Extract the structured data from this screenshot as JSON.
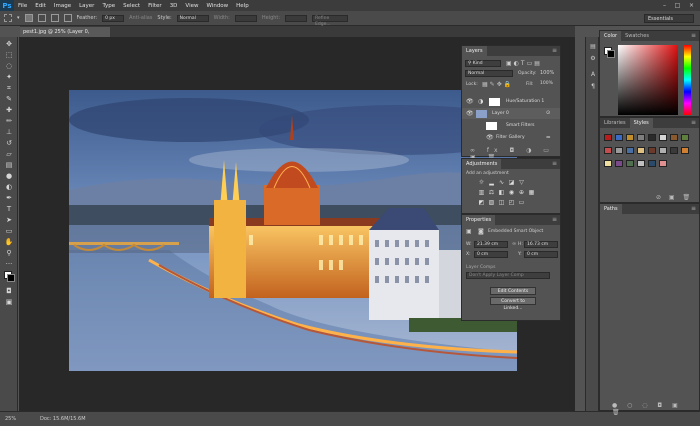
{
  "app": {
    "logo": "Ps"
  },
  "menu": [
    "File",
    "Edit",
    "Image",
    "Layer",
    "Type",
    "Select",
    "Filter",
    "3D",
    "View",
    "Window",
    "Help"
  ],
  "options": {
    "feather_label": "Feather:",
    "feather_value": "0 px",
    "antialias_label": "Anti-alias",
    "style_label": "Style:",
    "style_value": "Normal",
    "width_label": "Width:",
    "height_label": "Height:",
    "refine_label": "Refine Edge...",
    "workspace": "Essentials"
  },
  "document": {
    "tab_title": "pest1.jpg @ 25% (Layer 0, RGB/8*) ×"
  },
  "status": {
    "zoom": "25%",
    "doc": "Doc: 15.6M/15.6M"
  },
  "layers_panel": {
    "tab": "Layers",
    "kind_label": "Kind",
    "blend_mode": "Normal",
    "opacity_label": "Opacity:",
    "opacity_value": "100%",
    "lock_label": "Lock:",
    "fill_label": "Fill:",
    "fill_value": "100%",
    "layers": [
      {
        "name": "Hue/Saturation 1"
      },
      {
        "name": "Layer 0"
      },
      {
        "name": "Smart Filters"
      },
      {
        "name": "Filter Gallery"
      }
    ]
  },
  "adjustments_panel": {
    "tab": "Adjustments",
    "add_label": "Add an adjustment"
  },
  "properties_panel": {
    "tab": "Properties",
    "type_label": "Embedded Smart Object",
    "w_label": "W:",
    "w_value": "21.39 cm",
    "h_label": "H:",
    "h_value": "16.73 cm",
    "x_label": "X:",
    "x_value": "0 cm",
    "y_label": "Y:",
    "y_value": "0 cm",
    "comps_label": "Layer Comps",
    "comps_value": "Don't Apply Layer Comp",
    "edit_btn": "Edit Contents",
    "convert_btn": "Convert to Linked..."
  },
  "color_panel": {
    "tab1": "Color",
    "tab2": "Swatches"
  },
  "styles_panel": {
    "tab1": "Libraries",
    "tab2": "Styles"
  },
  "paths_panel": {
    "tab": "Paths"
  },
  "colors": {
    "swatches": [
      "#b61e1e",
      "#3b6bc4",
      "#c08e2a",
      "#7e7e7e",
      "#2a2a2a",
      "#d6d6d6",
      "#8a5a2e",
      "#5f7f3f",
      "#c44d4d",
      "#9b9b9b",
      "#4a6fa5",
      "#e0c080",
      "#6b3a2a",
      "#b0b0b0",
      "#3a3a3a",
      "#d08030",
      "#f0e0a0",
      "#7a4a8a",
      "#507050",
      "#c0c0c0",
      "#2a4a6a",
      "#e09090"
    ]
  }
}
